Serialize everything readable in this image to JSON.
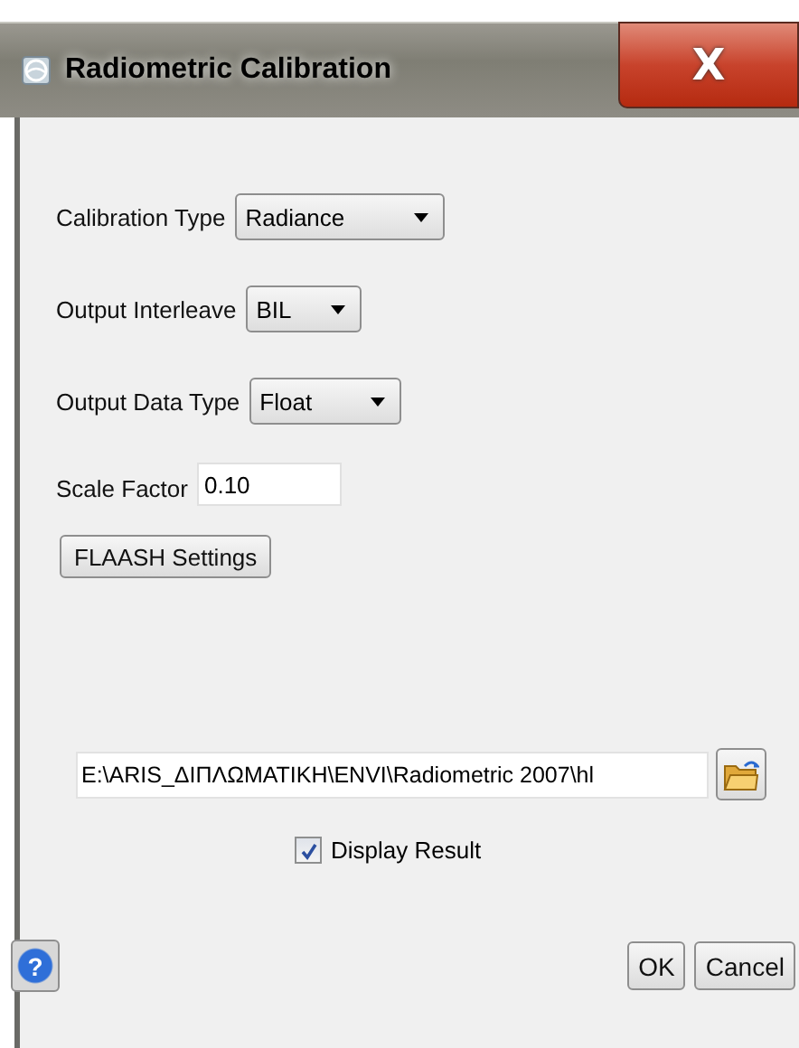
{
  "window": {
    "title": "Radiometric Calibration",
    "close": "X"
  },
  "fields": [
    {
      "kind": "dropdown",
      "label": "Calibration Type",
      "value": "Radiance"
    },
    {
      "kind": "dropdown",
      "label": "Output Interleave",
      "value": "BIL"
    },
    {
      "kind": "dropdown",
      "label": "Output Data Type",
      "value": "Float"
    },
    {
      "kind": "text",
      "label": "Scale Factor",
      "value": "0.10"
    }
  ],
  "flaash_button": "FLAASH Settings",
  "output_path": "E:\\ARIS_ΔΙΠΛΩΜΑΤΙΚΗ\\ENVI\\Radiometric 2007\\hl",
  "display_result": {
    "label": "Display Result",
    "checked": true
  },
  "help": "?",
  "buttons": [
    "OK",
    "Cancel"
  ]
}
